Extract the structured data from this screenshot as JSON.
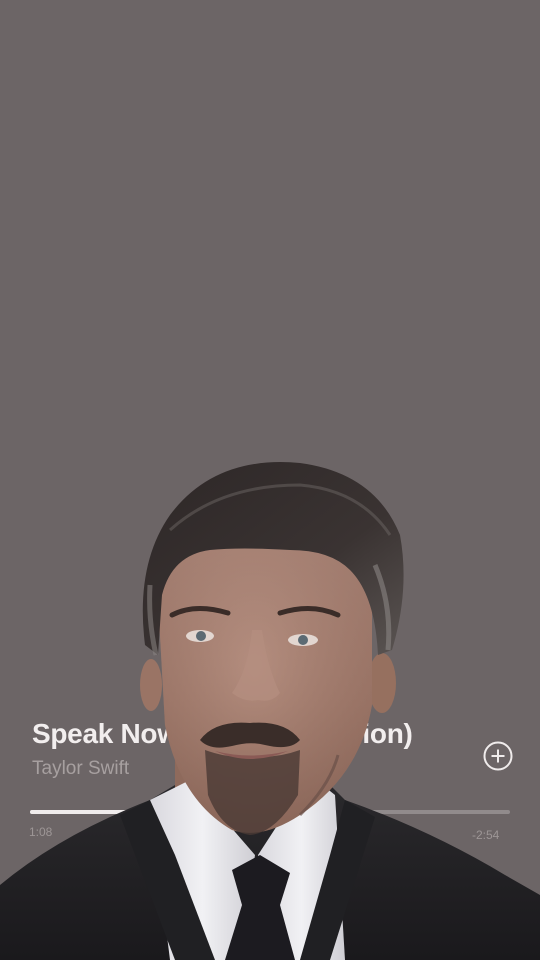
{
  "player": {
    "title": "Speak Now (Taylor's Version)",
    "artist": "Taylor Swift",
    "elapsed": "1:08",
    "remaining": "-2:54",
    "progress_fraction": 0.285,
    "icons": {
      "add": "plus-circle-icon",
      "next": "skip-next-icon",
      "repeat": "repeat-icon"
    }
  },
  "colors": {
    "background": "#6c6566",
    "text_primary": "#f2eeee",
    "text_secondary": "#a7a0a0"
  }
}
